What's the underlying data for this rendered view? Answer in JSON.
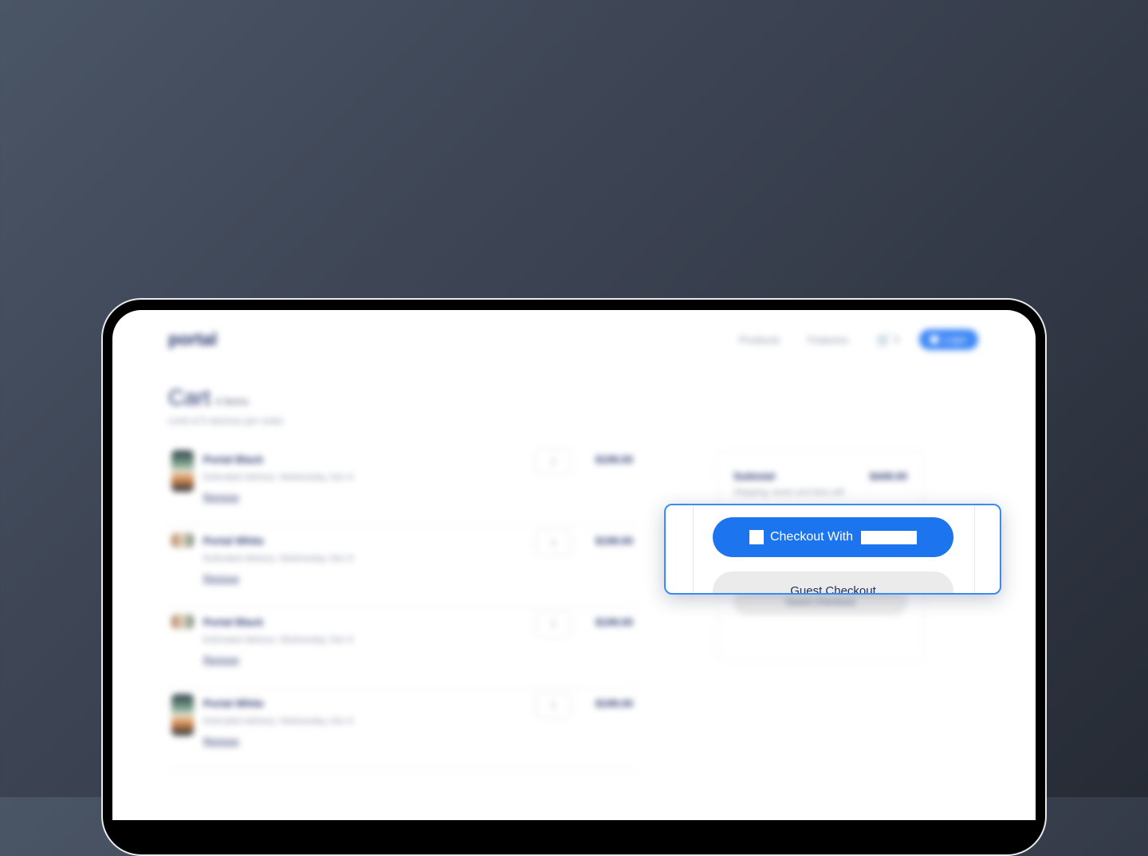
{
  "background": {
    "gradient_start": "#4a5566",
    "gradient_end": "#262b35"
  },
  "header": {
    "logo": "portal",
    "nav": [
      "Products",
      "Features"
    ],
    "cart_count": "4",
    "login_label": "Login",
    "accent_color": "#3d87f5"
  },
  "cart": {
    "title": "Cart",
    "item_count": "4 items",
    "subtitle": "Limit of 5 devices per order",
    "items": [
      {
        "name": "Portal Black",
        "delivery": "Estimated delivery: Wednesday, Dec 8",
        "remove": "Remove",
        "qty": "1",
        "price": "$199.00"
      },
      {
        "name": "Portal White",
        "delivery": "Estimated delivery: Wednesday, Dec 8",
        "remove": "Remove",
        "qty": "1",
        "price": "$199.00"
      },
      {
        "name": "Portal Black",
        "delivery": "Estimated delivery: Wednesday, Dec 8",
        "remove": "Remove",
        "qty": "1",
        "price": "$199.00"
      },
      {
        "name": "Portal White",
        "delivery": "Estimated delivery: Wednesday, Dec 8",
        "remove": "Remove",
        "qty": "1",
        "price": "$199.00"
      }
    ]
  },
  "summary": {
    "subtotal_label": "Subtotal",
    "subtotal_value": "$449.00",
    "note": "Shipping, taxes and fees will",
    "guest_label": "Guest Checkout"
  },
  "popup": {
    "checkout_label": "Checkout With",
    "guest_label": "Guest Checkout",
    "checkout_color": "#1d74ef",
    "border_color": "#3b8cf0",
    "icons": {
      "cart": "cart-icon",
      "checkout_logo": "brand-logo-icon"
    }
  }
}
